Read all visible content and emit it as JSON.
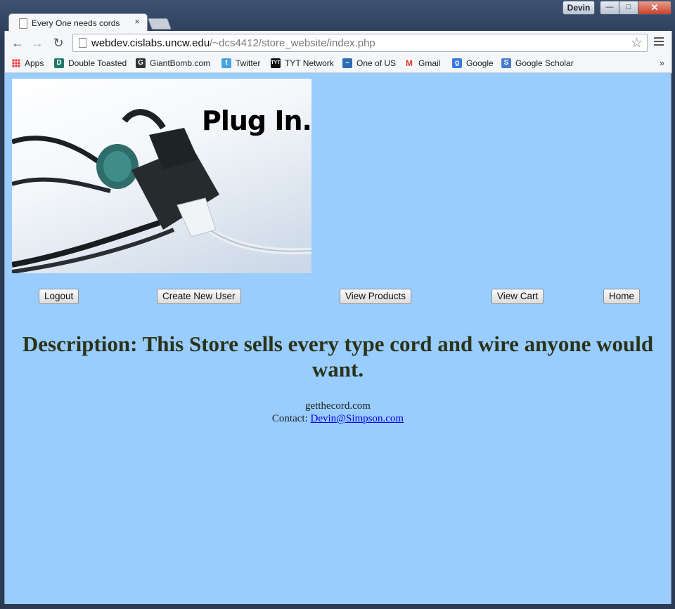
{
  "window": {
    "user_name": "Devin",
    "minimize_symbol": "—",
    "maximize_symbol": "□",
    "close_symbol": "✕"
  },
  "tab": {
    "title": "Every One needs cords",
    "close_symbol": "×"
  },
  "toolbar": {
    "back_symbol": "←",
    "forward_symbol": "→",
    "reload_symbol": "↻",
    "url_host": "webdev.cislabs.uncw.edu",
    "url_path": "/~dcs4412/store_website/index.php",
    "star_symbol": "☆"
  },
  "bookmarks": {
    "items": [
      {
        "label": "Apps",
        "icon": "apps-grid-icon",
        "color": "#e04a3a"
      },
      {
        "label": "Double Toasted",
        "icon": "double-toasted-icon",
        "color": "#1f7a6b"
      },
      {
        "label": "GiantBomb.com",
        "icon": "giantbomb-icon",
        "color": "#333333"
      },
      {
        "label": "Twitter",
        "icon": "twitter-bird-icon",
        "color": "#4aa3df"
      },
      {
        "label": "TYT Network",
        "icon": "tyt-icon",
        "color": "#111111"
      },
      {
        "label": "One of US",
        "icon": "one-of-us-icon",
        "color": "#2e6db4"
      },
      {
        "label": "Gmail",
        "icon": "gmail-icon",
        "color": "#d93025"
      },
      {
        "label": "Google",
        "icon": "google-icon",
        "color": "#3b78e7"
      },
      {
        "label": "Google Scholar",
        "icon": "google-scholar-icon",
        "color": "#4a7bd0"
      }
    ],
    "more_symbol": "»"
  },
  "page": {
    "background": "#99ccff",
    "banner_text": "Plug In.",
    "nav_buttons": {
      "logout": "Logout",
      "create_user": "Create New User",
      "view_products": "View Products",
      "view_cart": "View Cart",
      "home": "Home"
    },
    "description": "Description: This Store sells every type cord and wire anyone would want.",
    "footer_site": "getthecord.com",
    "footer_contact_label": "Contact: ",
    "footer_contact_email": "Devin@Simpson.com"
  }
}
